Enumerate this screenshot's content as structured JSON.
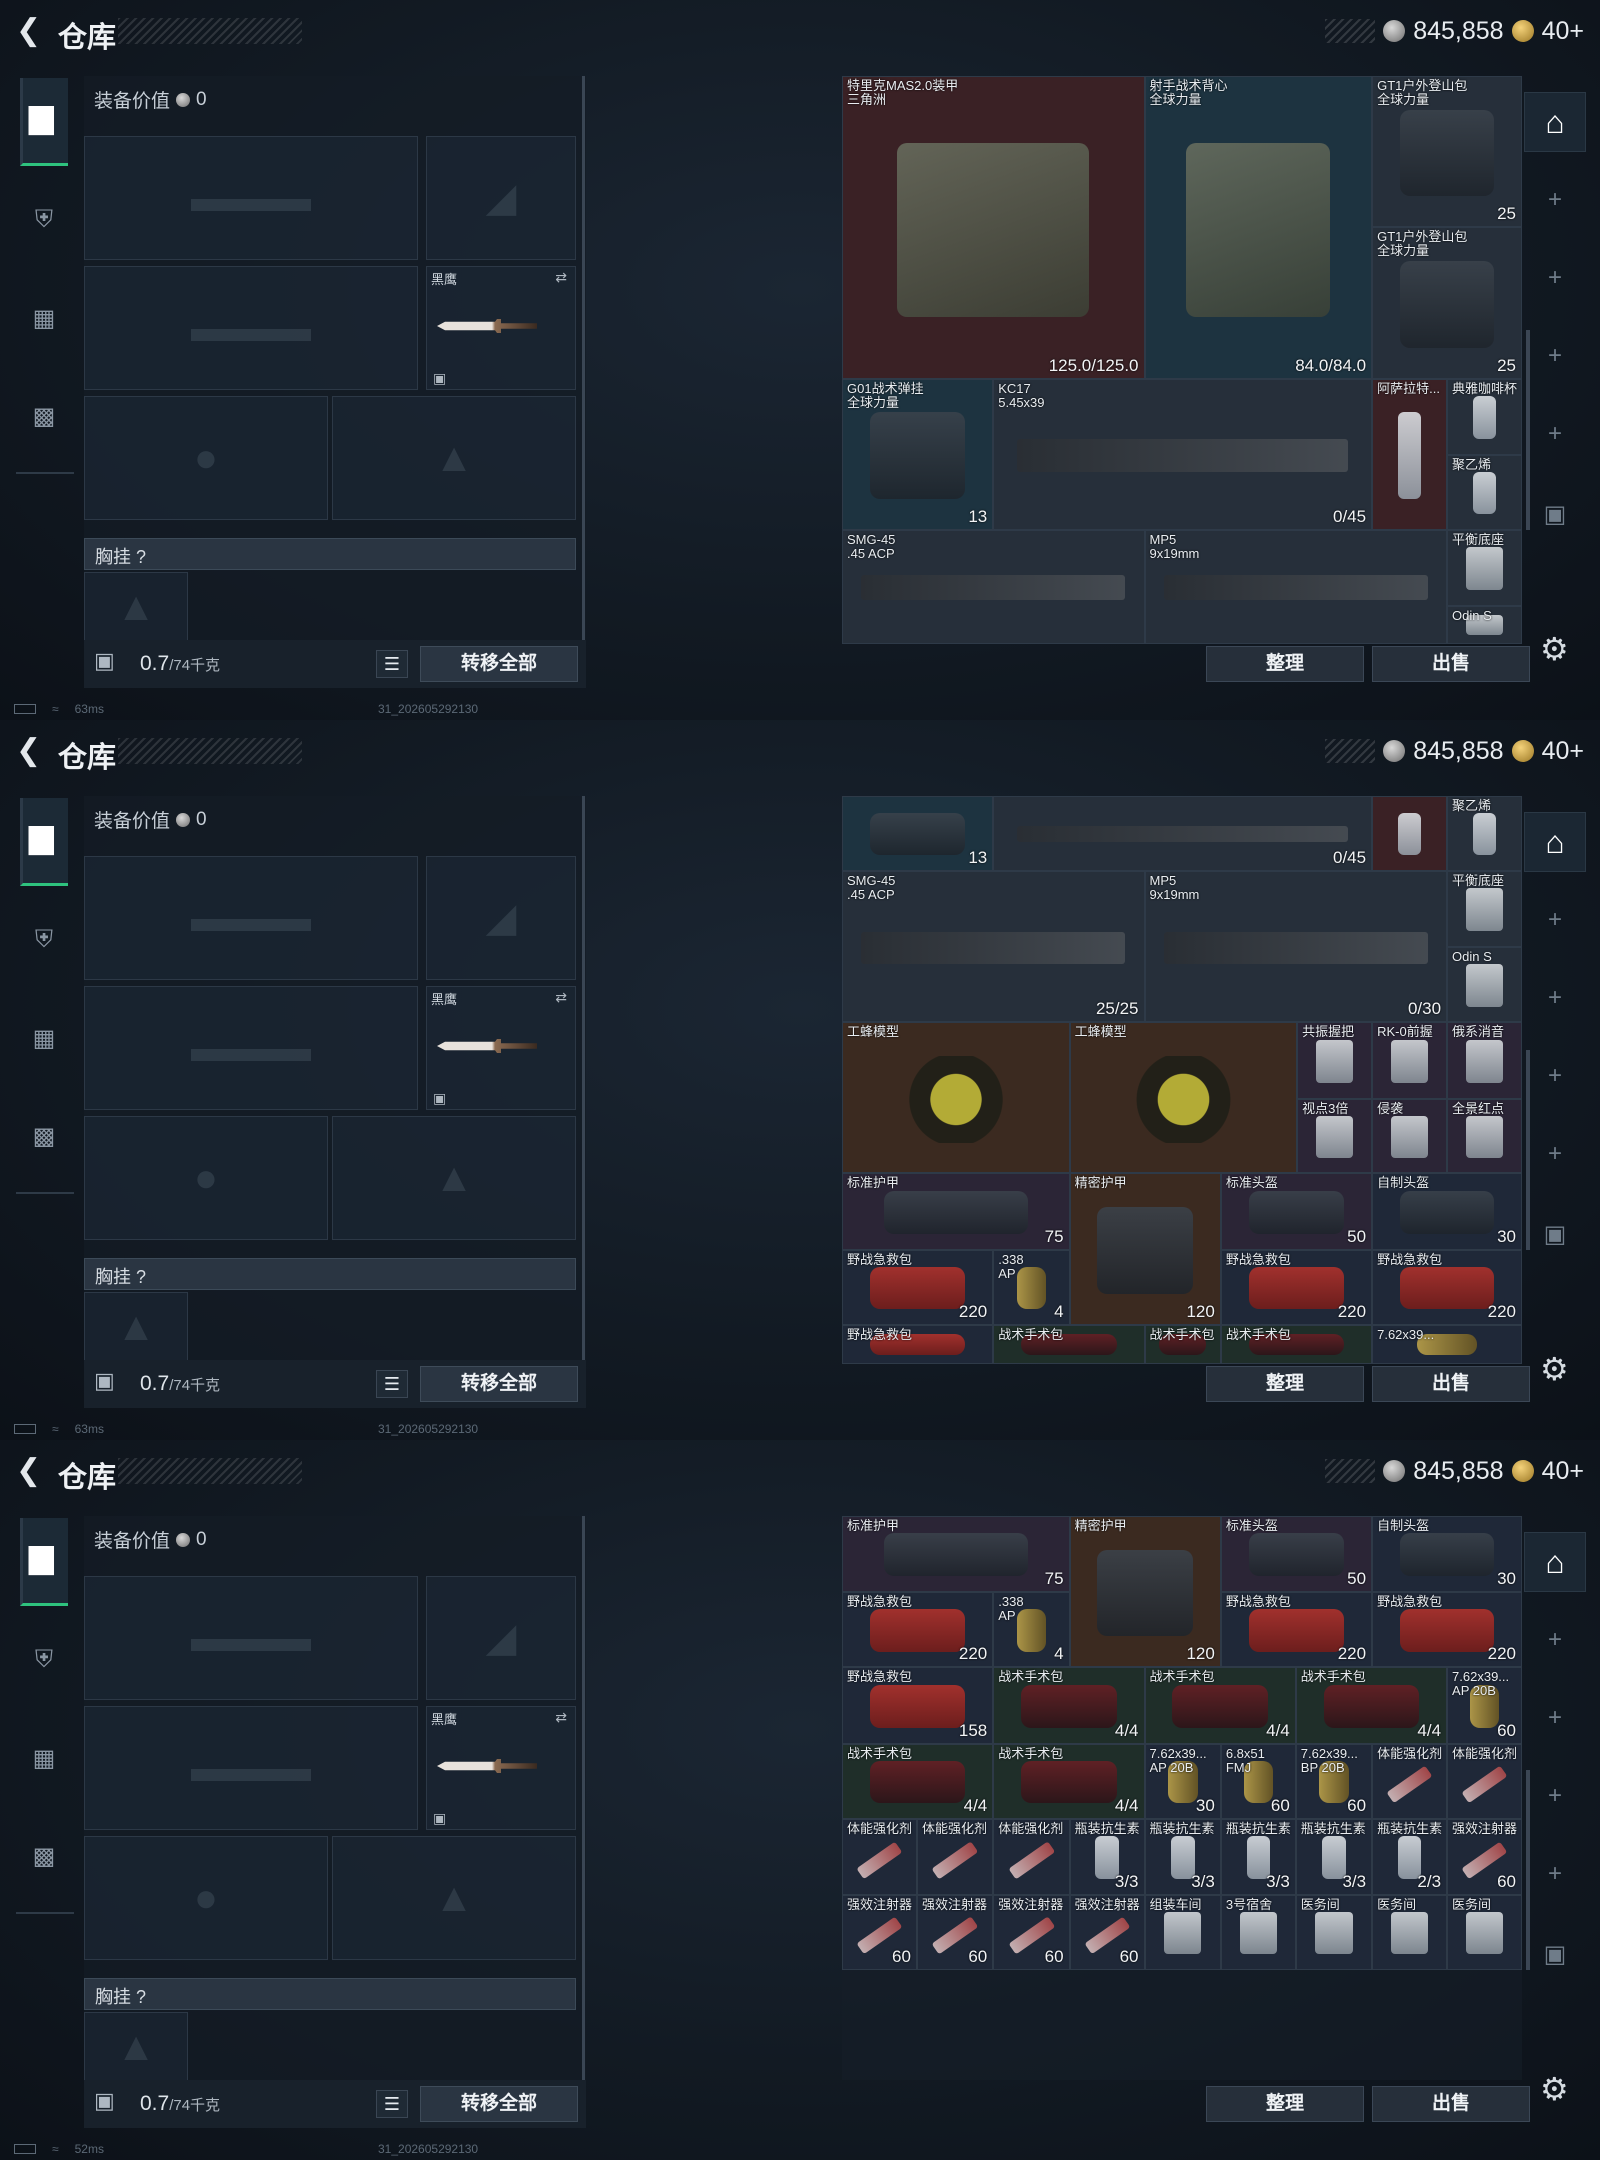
{
  "panels": [
    {
      "title": "仓库",
      "currency": {
        "silver": "845,858",
        "gold": "40+"
      },
      "equip_value_label": "装备价值",
      "equip_value": "0",
      "melee_name": "黑鹰",
      "chest_label": "胸挂",
      "weight": "0.7",
      "weight_unit": "/74千克",
      "transfer_label": "转移全部",
      "sort_label": "整理",
      "sell_label": "出售",
      "ping": "63ms",
      "build": "31_202605292130",
      "items": [
        {
          "n": "特里克MAS2.0装甲\n三角洲",
          "v": "125.0/125.0",
          "c": "red",
          "a": "vest"
        },
        {
          "n": "射手战术背心\n全球力量",
          "v": "84.0/84.0",
          "c": "teal",
          "a": "vest"
        },
        {
          "n": "GT1户外登山包\n全球力量",
          "v": "25",
          "c": "gray",
          "a": "bag"
        },
        {
          "n": "GT1户外登山包\n全球力量",
          "v": "25",
          "c": "gray",
          "a": "bag"
        },
        {
          "n": "G01战术弹挂\n全球力量",
          "v": "13",
          "c": "teal",
          "a": "bag"
        },
        {
          "n": "KC17\n5.45x39",
          "v": "0/45",
          "c": "gray",
          "a": "rifle"
        },
        {
          "n": "阿萨拉特...",
          "v": "",
          "c": "red",
          "a": "bottle"
        },
        {
          "n": "典雅咖啡杯",
          "v": "",
          "c": "gray",
          "a": "bottle"
        },
        {
          "n": "聚乙烯",
          "v": "",
          "c": "gray",
          "a": "bottle"
        },
        {
          "n": "SMG-45\n.45 ACP",
          "v": "",
          "c": "gray",
          "a": "rifle"
        },
        {
          "n": "MP5\n9x19mm",
          "v": "",
          "c": "gray",
          "a": "rifle"
        },
        {
          "n": "平衡底座",
          "v": "",
          "c": "gray",
          "a": "pack"
        },
        {
          "n": "Odin S",
          "v": "",
          "c": "gray",
          "a": "pack"
        }
      ]
    },
    {
      "title": "仓库",
      "currency": {
        "silver": "845,858",
        "gold": "40+"
      },
      "equip_value_label": "装备价值",
      "equip_value": "0",
      "melee_name": "黑鹰",
      "chest_label": "胸挂",
      "weight": "0.7",
      "weight_unit": "/74千克",
      "transfer_label": "转移全部",
      "sort_label": "整理",
      "sell_label": "出售",
      "ping": "63ms",
      "build": "31_202605292130",
      "items": [
        {
          "n": "",
          "v": "13",
          "c": "teal",
          "a": "bag"
        },
        {
          "n": "",
          "v": "0/45",
          "c": "gray",
          "a": "rifle"
        },
        {
          "n": "",
          "v": "",
          "c": "red",
          "a": "bottle"
        },
        {
          "n": "聚乙烯",
          "v": "",
          "c": "gray",
          "a": "bottle"
        },
        {
          "n": "SMG-45\n.45 ACP",
          "v": "25/25",
          "c": "gray",
          "a": "rifle"
        },
        {
          "n": "MP5\n9x19mm",
          "v": "0/30",
          "c": "gray",
          "a": "rifle"
        },
        {
          "n": "平衡底座",
          "v": "",
          "c": "gray",
          "a": "pack"
        },
        {
          "n": "Odin S",
          "v": "",
          "c": "gray",
          "a": "pack"
        },
        {
          "n": "工蜂模型",
          "v": "",
          "c": "brown",
          "a": "bee"
        },
        {
          "n": "工蜂模型",
          "v": "",
          "c": "brown",
          "a": "bee"
        },
        {
          "n": "共振握把",
          "v": "",
          "c": "purple",
          "a": "pack"
        },
        {
          "n": "RK-0前握",
          "v": "",
          "c": "purple",
          "a": "pack"
        },
        {
          "n": "俄系消音",
          "v": "",
          "c": "purple",
          "a": "pack"
        },
        {
          "n": "视点3倍",
          "v": "",
          "c": "purple",
          "a": "pack"
        },
        {
          "n": "侵袭",
          "v": "",
          "c": "purple",
          "a": "pack"
        },
        {
          "n": "全景红点",
          "v": "",
          "c": "purple",
          "a": "pack"
        },
        {
          "n": "标准护甲",
          "v": "75",
          "c": "purple",
          "a": "bag"
        },
        {
          "n": "精密护甲",
          "v": "120",
          "c": "brown",
          "a": "bag"
        },
        {
          "n": "标准头盔",
          "v": "50",
          "c": "purple",
          "a": "bag"
        },
        {
          "n": "自制头盔",
          "v": "30",
          "c": "navy",
          "a": "bag"
        },
        {
          "n": "野战急救包",
          "v": "220",
          "c": "navy",
          "a": "med"
        },
        {
          "n": ".338\nAP",
          "v": "4",
          "c": "navy",
          "a": "ammo"
        },
        {
          "n": "野战急救包",
          "v": "220",
          "c": "navy",
          "a": "med"
        },
        {
          "n": "野战急救包",
          "v": "220",
          "c": "navy",
          "a": "med"
        },
        {
          "n": "野战急救包",
          "v": "",
          "c": "navy",
          "a": "med"
        },
        {
          "n": "战术手术包",
          "v": "",
          "c": "green",
          "a": "kit"
        },
        {
          "n": "战术手术包",
          "v": "",
          "c": "green",
          "a": "kit"
        },
        {
          "n": "战术手术包",
          "v": "",
          "c": "green",
          "a": "kit"
        },
        {
          "n": "7.62x39...",
          "v": "",
          "c": "navy",
          "a": "ammo"
        }
      ]
    },
    {
      "title": "仓库",
      "currency": {
        "silver": "845,858",
        "gold": "40+"
      },
      "equip_value_label": "装备价值",
      "equip_value": "0",
      "melee_name": "黑鹰",
      "chest_label": "胸挂",
      "weight": "0.7",
      "weight_unit": "/74千克",
      "transfer_label": "转移全部",
      "sort_label": "整理",
      "sell_label": "出售",
      "ping": "52ms",
      "build": "31_202605292130",
      "items": [
        {
          "n": "标准护甲",
          "v": "75",
          "c": "purple",
          "a": "bag"
        },
        {
          "n": "精密护甲",
          "v": "120",
          "c": "brown",
          "a": "bag"
        },
        {
          "n": "标准头盔",
          "v": "50",
          "c": "purple",
          "a": "bag"
        },
        {
          "n": "自制头盔",
          "v": "30",
          "c": "navy",
          "a": "bag"
        },
        {
          "n": "野战急救包",
          "v": "220",
          "c": "navy",
          "a": "med"
        },
        {
          "n": ".338\nAP",
          "v": "4",
          "c": "navy",
          "a": "ammo"
        },
        {
          "n": "野战急救包",
          "v": "220",
          "c": "navy",
          "a": "med"
        },
        {
          "n": "野战急救包",
          "v": "220",
          "c": "navy",
          "a": "med"
        },
        {
          "n": "野战急救包",
          "v": "158",
          "c": "navy",
          "a": "med"
        },
        {
          "n": "战术手术包",
          "v": "4/4",
          "c": "green",
          "a": "kit"
        },
        {
          "n": "战术手术包",
          "v": "4/4",
          "c": "green",
          "a": "kit"
        },
        {
          "n": "战术手术包",
          "v": "4/4",
          "c": "green",
          "a": "kit"
        },
        {
          "n": "7.62x39...\nAP 20B",
          "v": "60",
          "c": "navy",
          "a": "ammo"
        },
        {
          "n": "战术手术包",
          "v": "4/4",
          "c": "green",
          "a": "kit"
        },
        {
          "n": "战术手术包",
          "v": "4/4",
          "c": "green",
          "a": "kit"
        },
        {
          "n": "7.62x39...\nAP 20B",
          "v": "30",
          "c": "navy",
          "a": "ammo"
        },
        {
          "n": "6.8x51\nFMJ",
          "v": "60",
          "c": "navy",
          "a": "ammo"
        },
        {
          "n": "7.62x39...\nBP 20B",
          "v": "60",
          "c": "navy",
          "a": "ammo"
        },
        {
          "n": "体能强化剂",
          "v": "",
          "c": "navy",
          "a": "syr"
        },
        {
          "n": "体能强化剂",
          "v": "",
          "c": "navy",
          "a": "syr"
        },
        {
          "n": "体能强化剂",
          "v": "",
          "c": "navy",
          "a": "syr"
        },
        {
          "n": "体能强化剂",
          "v": "",
          "c": "navy",
          "a": "syr"
        },
        {
          "n": "体能强化剂",
          "v": "",
          "c": "navy",
          "a": "syr"
        },
        {
          "n": "瓶装抗生素",
          "v": "3/3",
          "c": "navy",
          "a": "bottle"
        },
        {
          "n": "瓶装抗生素",
          "v": "3/3",
          "c": "navy",
          "a": "bottle"
        },
        {
          "n": "瓶装抗生素",
          "v": "3/3",
          "c": "navy",
          "a": "bottle"
        },
        {
          "n": "瓶装抗生素",
          "v": "3/3",
          "c": "navy",
          "a": "bottle"
        },
        {
          "n": "瓶装抗生素",
          "v": "2/3",
          "c": "navy",
          "a": "bottle"
        },
        {
          "n": "强效注射器",
          "v": "60",
          "c": "navy",
          "a": "syr"
        },
        {
          "n": "强效注射器",
          "v": "60",
          "c": "navy",
          "a": "syr"
        },
        {
          "n": "强效注射器",
          "v": "60",
          "c": "navy",
          "a": "syr"
        },
        {
          "n": "强效注射器",
          "v": "60",
          "c": "navy",
          "a": "syr"
        },
        {
          "n": "强效注射器",
          "v": "60",
          "c": "navy",
          "a": "syr"
        },
        {
          "n": "组装车间",
          "v": "",
          "c": "navy",
          "a": "pack"
        },
        {
          "n": "3号宿舍",
          "v": "",
          "c": "navy",
          "a": "pack"
        },
        {
          "n": "医务间",
          "v": "",
          "c": "navy",
          "a": "pack"
        },
        {
          "n": "医务间",
          "v": "",
          "c": "navy",
          "a": "pack"
        },
        {
          "n": "医务间",
          "v": "",
          "c": "navy",
          "a": "pack"
        }
      ]
    }
  ]
}
